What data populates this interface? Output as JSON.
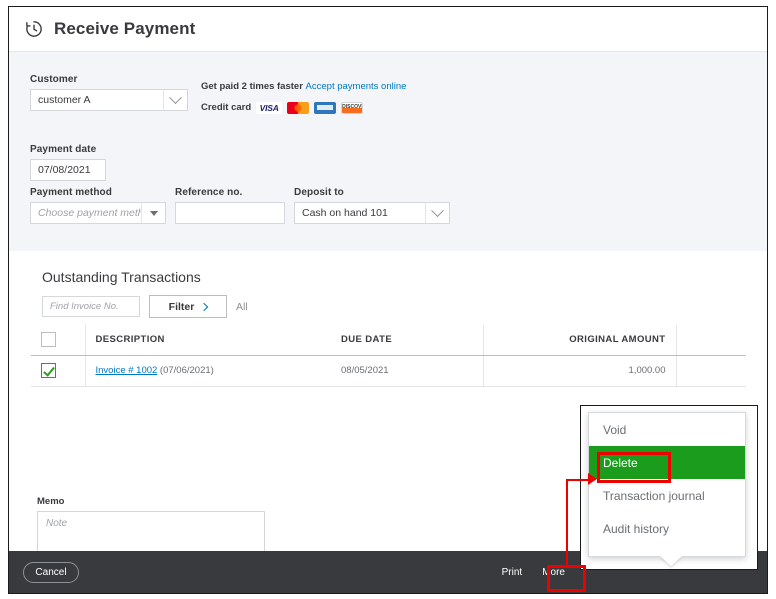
{
  "header": {
    "icon": "clock-history-icon",
    "title": "Receive Payment"
  },
  "form": {
    "customer": {
      "label": "Customer",
      "value": "customer A"
    },
    "payment_date": {
      "label": "Payment date",
      "value": "07/08/2021"
    },
    "payment_method": {
      "label": "Payment method",
      "placeholder": "Choose payment method",
      "value": ""
    },
    "reference_no": {
      "label": "Reference no.",
      "value": ""
    },
    "deposit_to": {
      "label": "Deposit to",
      "value": "Cash on hand 101"
    }
  },
  "promo": {
    "line1_text": "Get paid 2 times faster ",
    "line1_link": "Accept payments online",
    "line2_label": "Credit card",
    "cards": [
      "VISA",
      "Mastercard",
      "American Express",
      "Discover"
    ]
  },
  "outstanding": {
    "title": "Outstanding Transactions",
    "find_placeholder": "Find Invoice No.",
    "find_value": "",
    "filter_label": "Filter",
    "all_label": "All",
    "columns": [
      "",
      "DESCRIPTION",
      "DUE DATE",
      "ORIGINAL AMOUNT",
      ""
    ],
    "header_checkbox_checked": false,
    "rows": [
      {
        "checked": true,
        "description_link": "Invoice # 1002",
        "description_suffix": " (07/06/2021)",
        "due_date": "08/05/2021",
        "original_amount": "1,000.00",
        "trailing": ""
      }
    ]
  },
  "memo": {
    "label": "Memo",
    "placeholder": "Note",
    "value": ""
  },
  "footer": {
    "cancel_label": "Cancel",
    "print_label": "Print",
    "more_label": "More"
  },
  "more_menu": {
    "items": [
      {
        "label": "Void",
        "highlighted": false
      },
      {
        "label": "Delete",
        "highlighted": true
      },
      {
        "label": "Transaction journal",
        "highlighted": false
      },
      {
        "label": "Audit history",
        "highlighted": false
      }
    ]
  },
  "annotations": {
    "highlight_color": "#1c9c1c",
    "callout_color": "#ef0000",
    "boxed_items": [
      "Delete",
      "More"
    ]
  }
}
